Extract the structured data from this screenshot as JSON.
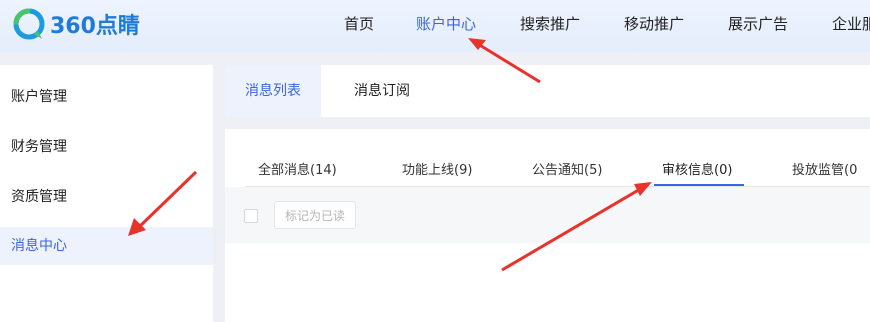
{
  "logo": {
    "text": "360点睛",
    "icon": "360-logo-icon",
    "color": "#1e7bd9"
  },
  "topnav": {
    "items": [
      {
        "label": "首页",
        "active": false
      },
      {
        "label": "账户中心",
        "active": true
      },
      {
        "label": "搜索推广",
        "active": false
      },
      {
        "label": "移动推广",
        "active": false
      },
      {
        "label": "展示广告",
        "active": false
      },
      {
        "label": "企业服",
        "active": false
      }
    ]
  },
  "sidebar": {
    "items": [
      {
        "label": "账户管理",
        "active": false
      },
      {
        "label": "财务管理",
        "active": false
      },
      {
        "label": "资质管理",
        "active": false
      },
      {
        "label": "消息中心",
        "active": true
      }
    ]
  },
  "subtabs": {
    "items": [
      {
        "label": "消息列表",
        "active": true
      },
      {
        "label": "消息订阅",
        "active": false
      }
    ]
  },
  "message_tabs": {
    "items": [
      {
        "label": "全部消息(14)",
        "active": false
      },
      {
        "label": "功能上线(9)",
        "active": false
      },
      {
        "label": "公告通知(5)",
        "active": false
      },
      {
        "label": "审核信息(0)",
        "active": true
      },
      {
        "label": "投放监管(0",
        "active": false
      }
    ]
  },
  "actions": {
    "mark_read_label": "标记为已读"
  },
  "colors": {
    "accent": "#3a66e0",
    "arrow": "#e8322b",
    "background": "#eef0f5"
  }
}
